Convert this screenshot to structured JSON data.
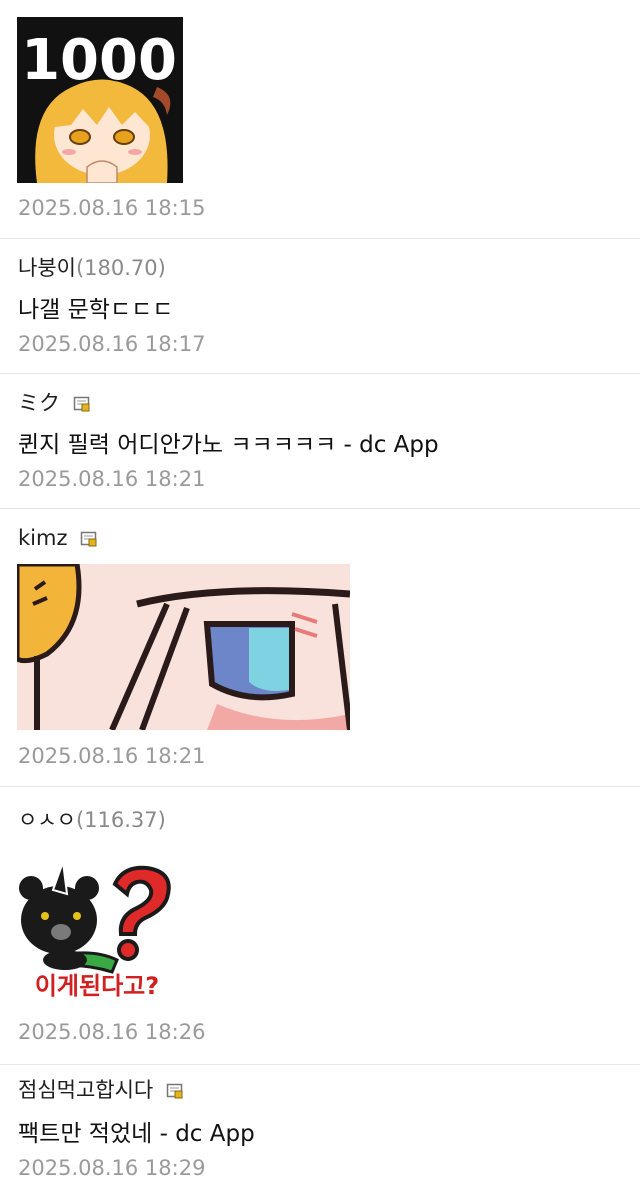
{
  "comments": [
    {
      "nickname": "",
      "image_text": "1000",
      "date": "2025.08.16 18:15"
    },
    {
      "nickname": "나붕이",
      "ip": "(180.70)",
      "text": "나갤 문학ㄷㄷㄷ",
      "date": "2025.08.16 18:17"
    },
    {
      "nickname": "ミク",
      "text": "퀸지 필력 어디안가노 ㅋㅋㅋㅋㅋ - dc App",
      "date": "2025.08.16 18:21"
    },
    {
      "nickname": "kimz",
      "date": "2025.08.16 18:21"
    },
    {
      "nickname": "ㅇㅅㅇ",
      "ip": "(116.37)",
      "sticker_text": "이게된다고?",
      "date": "2025.08.16 18:26"
    },
    {
      "nickname": "점심먹고합시다",
      "text": "팩트만 적었네 - dc App",
      "date": "2025.08.16 18:29"
    }
  ],
  "colors": {
    "date": "#9a9a9a",
    "ip": "#8a8a8a",
    "divider": "#e6e6e6"
  }
}
